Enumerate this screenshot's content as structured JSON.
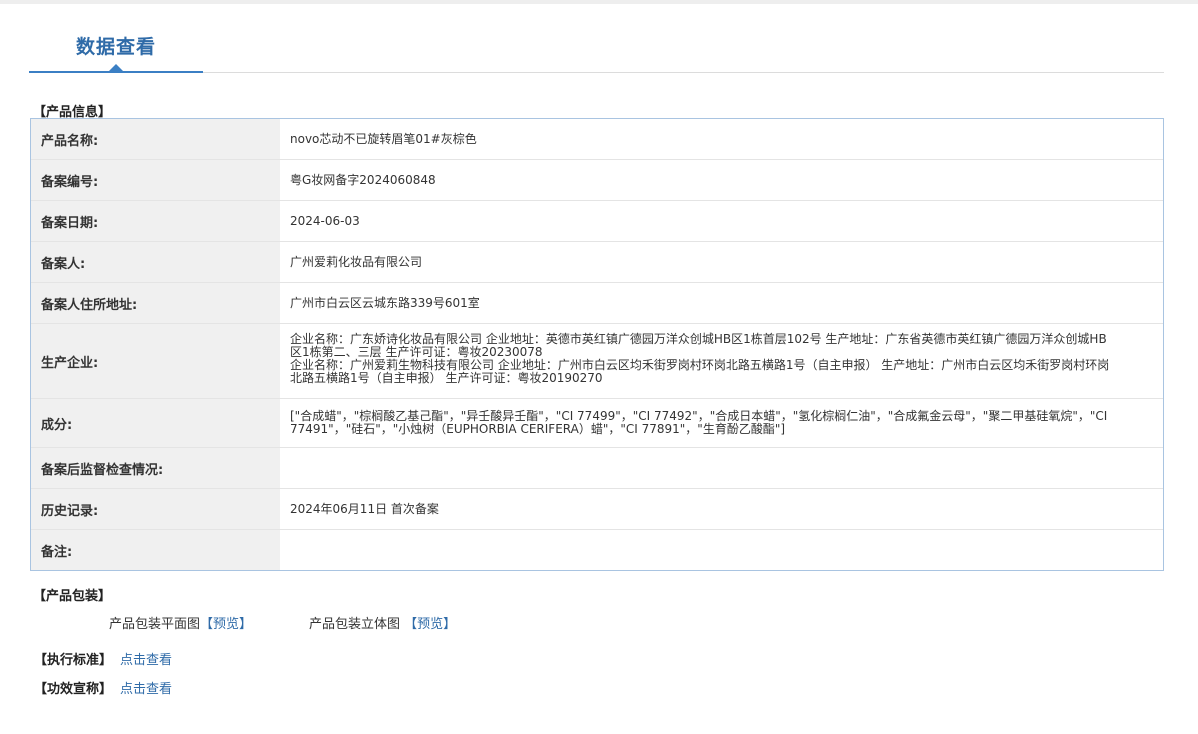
{
  "header": {
    "tab_title": "数据查看"
  },
  "product_info": {
    "section_title": "【产品信息】",
    "rows": [
      {
        "label": "产品名称:",
        "value": "novo芯动不已旋转眉笔01#灰棕色"
      },
      {
        "label": "备案编号:",
        "value": "粤G妆网备字2024060848"
      },
      {
        "label": "备案日期:",
        "value": "2024-06-03"
      },
      {
        "label": "备案人:",
        "value": "广州爱莉化妆品有限公司"
      },
      {
        "label": "备案人住所地址:",
        "value": "广州市白云区云城东路339号601室"
      },
      {
        "label": "生产企业:",
        "lines": [
          "企业名称：广东娇诗化妆品有限公司 企业地址：英德市英红镇广德园万洋众创城HB区1栋首层102号 生产地址：广东省英德市英红镇广德园万洋众创城HB区1栋第二、三层 生产许可证：粤妆20230078",
          "企业名称：广州爱莉生物科技有限公司 企业地址：广州市白云区均禾街罗岗村环岗北路五横路1号（自主申报） 生产地址：广州市白云区均禾街罗岗村环岗北路五横路1号（自主申报） 生产许可证：粤妆20190270"
        ]
      },
      {
        "label": "成分:",
        "value": "[\"合成蜡\"，\"棕榈酸乙基己酯\"，\"异壬酸异壬酯\"，\"CI 77499\"，\"CI 77492\"，\"合成日本蜡\"，\"氢化棕榈仁油\"，\"合成氟金云母\"，\"聚二甲基硅氧烷\"，\"CI 77491\"，\"硅石\"，\"小烛树（EUPHORBIA CERIFERA）蜡\"，\"CI 77891\"，\"生育酚乙酸酯\"]"
      },
      {
        "label": "备案后监督检查情况:",
        "value": ""
      },
      {
        "label": "历史记录:",
        "value": "2024年06月11日 首次备案"
      },
      {
        "label": "备注:",
        "value": ""
      }
    ]
  },
  "packaging": {
    "section_title": "【产品包装】",
    "flat_label": "产品包装平面图",
    "flat_link": "【预览】",
    "threed_label": "产品包装立体图",
    "threed_link": "【预览】"
  },
  "standard": {
    "label": "【执行标准】",
    "link": "点击查看"
  },
  "efficacy": {
    "label": "【功效宣称】",
    "link": "点击查看"
  }
}
